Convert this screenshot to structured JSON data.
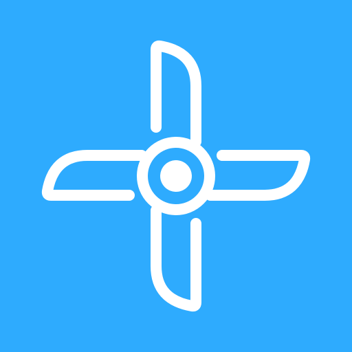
{
  "icon": {
    "name": "propeller-fan-icon",
    "colors": {
      "background": "#2EABFE",
      "foreground": "#FFFFFF"
    }
  }
}
